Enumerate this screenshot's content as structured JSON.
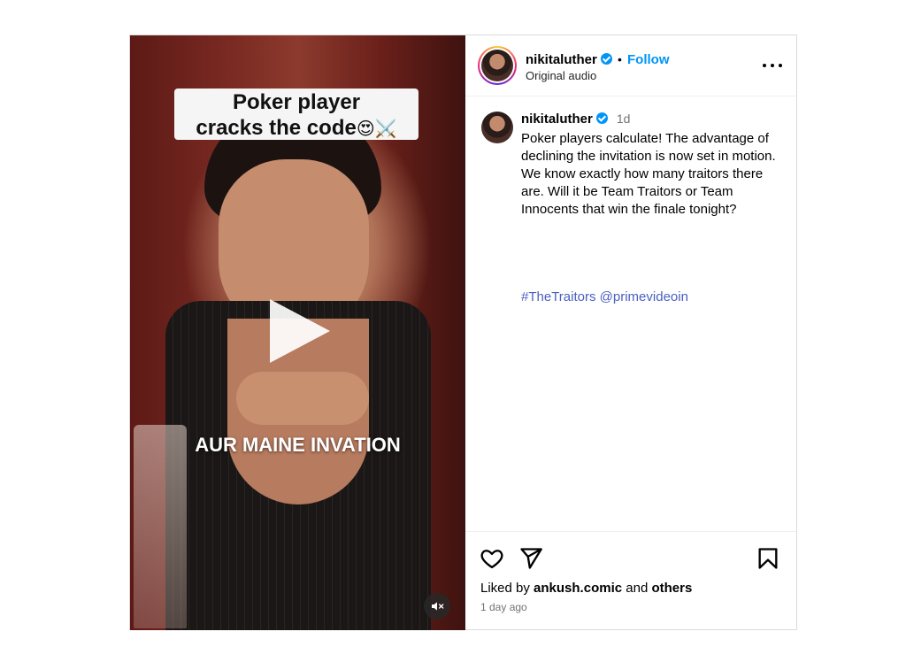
{
  "post": {
    "media": {
      "caption_line1": "Poker player",
      "caption_line2": "cracks the code",
      "caption_emoji": "😍⚔️",
      "subtitle": "AUR MAINE INVATION",
      "play_icon": "play-icon",
      "mute_icon": "speaker-muted-icon"
    },
    "header": {
      "username": "nikitaluther",
      "separator": "•",
      "follow_label": "Follow",
      "audio": "Original audio",
      "more_icon": "more-options-icon"
    },
    "caption": {
      "username": "nikitaluther",
      "time": "1d",
      "text": "Poker players calculate! The advantage of declining the invitation is now set in motion. We know exactly how many traitors there are. Will it be Team Traitors or Team Innocents that win the finale tonight?",
      "hashtag": "#TheTraitors",
      "mention": "@primevideoin"
    },
    "actions": {
      "like_icon": "heart-icon",
      "share_icon": "send-icon",
      "save_icon": "bookmark-icon",
      "liked_prefix": "Liked by",
      "liked_user": "ankush.comic",
      "liked_and": "and",
      "liked_others": "others",
      "posted_ago": "1 day ago"
    },
    "colors": {
      "accent": "#0095f6",
      "link": "#4a5fc1"
    }
  }
}
